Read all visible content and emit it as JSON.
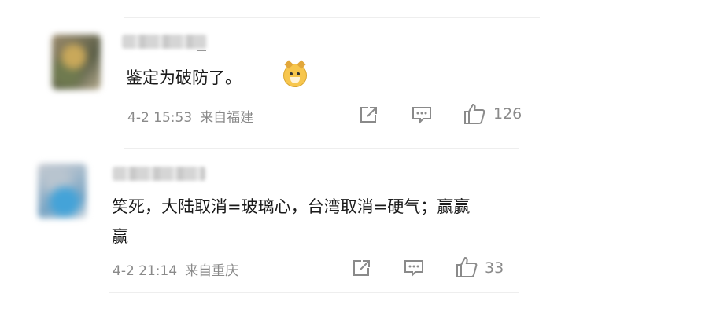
{
  "comments": [
    {
      "text": "鉴定为破防了。",
      "emoji": "doge-emoji",
      "date": "4-2 15:53",
      "location": "来自福建",
      "likes": "126"
    },
    {
      "text": "笑死，大陆取消=玻璃心，台湾取消=硬气；赢赢赢",
      "date": "4-2 21:14",
      "location": "来自重庆",
      "likes": "33"
    }
  ],
  "icons": [
    "share-icon",
    "comment-icon",
    "like-icon"
  ]
}
